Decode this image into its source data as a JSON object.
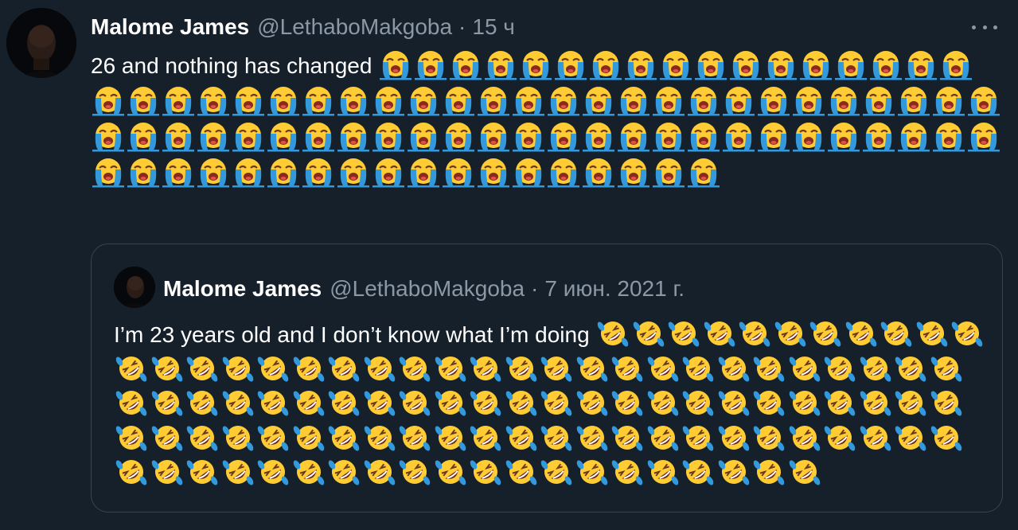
{
  "tweet": {
    "author_name": "Malome James",
    "author_handle": "@LethaboMakgoba",
    "separator": "·",
    "time": "15 ч",
    "text": "26 and nothing has changed ",
    "emoji_icon": "loudly-crying-face-icon",
    "emoji_count": 87
  },
  "quoted_tweet": {
    "author_name": "Malome James",
    "author_handle": "@LethaboMakgoba",
    "separator": "·",
    "date": "7 июн. 2021 г.",
    "text": "I’m 23 years old and I don’t know what I’m doing ",
    "emoji_icon": "rolling-on-floor-laughing-icon",
    "emoji_count": 103
  },
  "colors": {
    "background": "#15202b",
    "text": "#ffffff",
    "secondary_text": "#8b98a5",
    "quote_border": "#38444d",
    "emoji_face": "#ffcc33",
    "emoji_tears": "#3399dd"
  }
}
